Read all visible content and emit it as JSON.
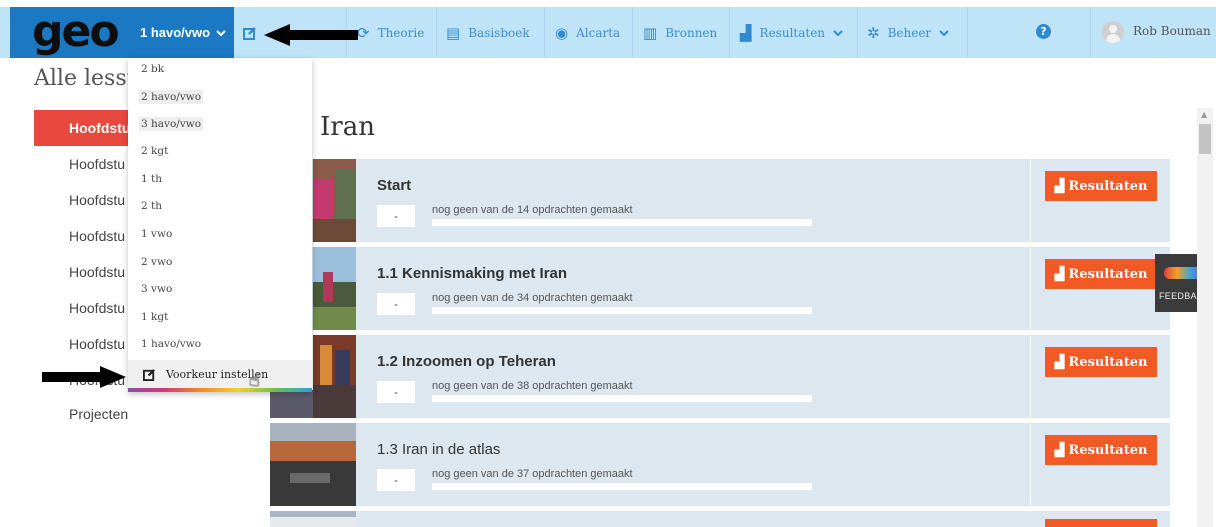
{
  "app": {
    "logo": "geo",
    "accent": "#1a79c2",
    "nav_bg": "#bfe3f7",
    "button_color": "#f15a24",
    "active_color": "#e8493f"
  },
  "nav": {
    "level": "1 havo/vwo",
    "items": [
      {
        "label": "Theorie",
        "icon": "refresh-icon"
      },
      {
        "label": "Basisboek",
        "icon": "book-icon"
      },
      {
        "label": "Alcarta",
        "icon": "globe-icon"
      },
      {
        "label": "Bronnen",
        "icon": "open-book-icon"
      },
      {
        "label": "Resultaten",
        "icon": "chart-icon"
      },
      {
        "label": "Beheer",
        "icon": "gear-icon"
      }
    ],
    "user": "Rob Bouman",
    "help": "?"
  },
  "sidebar": {
    "heading": "Alle lesst",
    "items": [
      {
        "label": "Hoofdstu"
      },
      {
        "label": "Hoofdstu"
      },
      {
        "label": "Hoofdstu"
      },
      {
        "label": "Hoofdstu"
      },
      {
        "label": "Hoofdstu"
      },
      {
        "label": "Hoofdstu"
      },
      {
        "label": "Hoofdstu"
      },
      {
        "label": "Hoofdstu"
      },
      {
        "label": "Projecten"
      }
    ]
  },
  "dropdown": {
    "options": [
      "2 bk",
      "2 havo/vwo",
      "3 havo/vwo",
      "2 kgt",
      "1 th",
      "2 th",
      "1 vwo",
      "2 vwo",
      "3 vwo",
      "1 kgt",
      "1 havo/vwo"
    ],
    "preference": "Voorkeur instellen"
  },
  "main": {
    "title": "Iran",
    "lessons": [
      {
        "title": "Start",
        "score": "-",
        "progress": "nog geen van de 14 opdrachten gemaakt",
        "button": "Resultaten"
      },
      {
        "title": "1.1 Kennismaking met Iran",
        "score": "-",
        "progress": "nog geen van de 34 opdrachten gemaakt",
        "button": "Resultaten"
      },
      {
        "title": "1.2 Inzoomen op Teheran",
        "score": "-",
        "progress": "nog geen van de 38 opdrachten gemaakt",
        "button": "Resultaten"
      },
      {
        "title": "1.3 Iran in de atlas",
        "score": "-",
        "progress": "nog geen van de 37 opdrachten gemaakt",
        "button": "Resultaten"
      }
    ]
  },
  "feedback": {
    "label": "FEEDBACK"
  }
}
